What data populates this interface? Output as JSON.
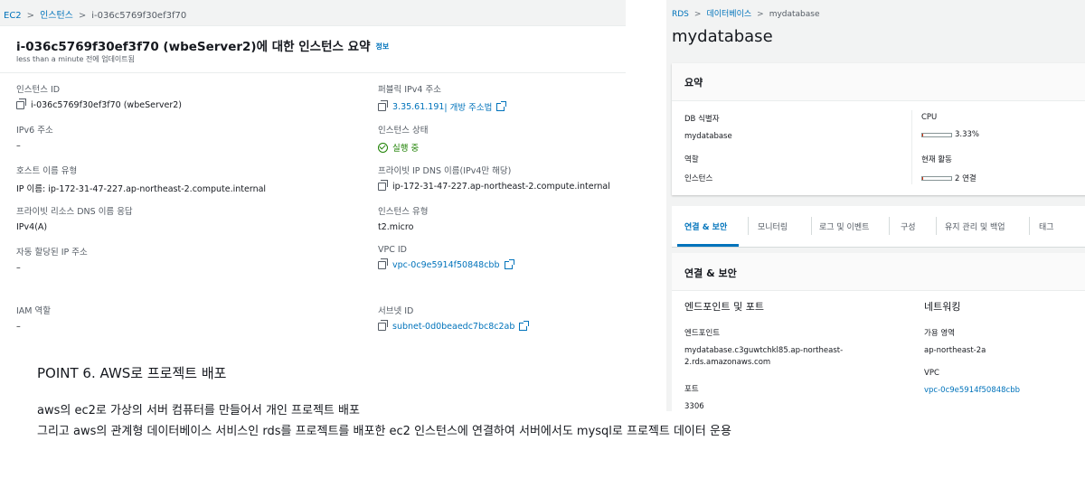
{
  "ec2": {
    "breadcrumb": [
      "EC2",
      "인스턴스",
      "i-036c5769f30ef3f70"
    ],
    "title": "i-036c5769f30ef3f70 (wbeServer2)에 대한 인스턴스 요약",
    "info_link": "정보",
    "subtitle": "less than a minute 전에 업데이트됨",
    "left_fields": [
      {
        "label": "인스턴스 ID",
        "value": "i-036c5769f30ef3f70 (wbeServer2)"
      },
      {
        "label": "IPv6 주소",
        "value": "–"
      },
      {
        "label": "호스트 이름 유형",
        "value": "IP 이름: ip-172-31-47-227.ap-northeast-2.compute.internal"
      },
      {
        "label": "프라이빗 리소스 DNS 이름 응답",
        "value": "IPv4(A)"
      },
      {
        "label": "자동 할당된 IP 주소",
        "value": "–"
      },
      {
        "label": "IAM 역할",
        "value": "–"
      }
    ],
    "right_fields": [
      {
        "label": "퍼블릭 IPv4 주소",
        "value": "3.35.61.191",
        "suffix": " | 개방 주소법"
      },
      {
        "label": "인스턴스 상태",
        "value": "실행 중"
      },
      {
        "label": "프라이빗 IP DNS 이름(IPv4만 해당)",
        "value": "ip-172-31-47-227.ap-northeast-2.compute.internal"
      },
      {
        "label": "인스턴스 유형",
        "value": "t2.micro"
      },
      {
        "label": "VPC ID",
        "value": "vpc-0c9e5914f50848cbb"
      },
      {
        "label": "서브넷 ID",
        "value": "subnet-0d0beaedc7bc8c2ab"
      }
    ]
  },
  "rds": {
    "breadcrumb": [
      "RDS",
      "데이터베이스",
      "mydatabase"
    ],
    "title": "mydatabase",
    "summary_heading": "요약",
    "summary": {
      "db_id_label": "DB 식별자",
      "db_id_value": "mydatabase",
      "role_label": "역할",
      "role_value": "인스턴스",
      "cpu_label": "CPU",
      "cpu_value": "3.33%",
      "cpu_fraction": 0.0333,
      "activity_label": "현재 활동",
      "activity_value": "2 연결",
      "activity_fraction": 0.02
    },
    "tabs": [
      "연결 & 보안",
      "모니터링",
      "로그 및 이벤트",
      "구성",
      "유지 관리 및 백업",
      "태그"
    ],
    "connection_heading": "연결 & 보안",
    "endpoint_section": "엔드포인트 및 포트",
    "endpoint_label": "엔드포인트",
    "endpoint_line1": "mydatabase.c3guwtchkl85.ap-northeast-",
    "endpoint_line2": "2.rds.amazonaws.com",
    "port_label": "포트",
    "port_value": "3306",
    "network_section": "네트워킹",
    "az_label": "가용 영역",
    "az_value": "ap-northeast-2a",
    "vpc_label": "VPC",
    "vpc_value": "vpc-0c9e5914f50848cbb"
  },
  "caption": {
    "heading": "POINT 6. AWS로 프로젝트 배포",
    "line1": "aws의 ec2로 가상의 서버 컴퓨터를 만들어서 개인 프로젝트 배포",
    "line2": "그리고 aws의 관계형 데이터베이스 서비스인 rds를 프로젝트를 배포한 ec2 인스턴스에 연결하여 서버에서도 mysql로 프로젝트 데이터 운용"
  },
  "colors": {
    "link": "#0073bb",
    "success": "#1d8102",
    "bar_fill": "#d13212"
  }
}
